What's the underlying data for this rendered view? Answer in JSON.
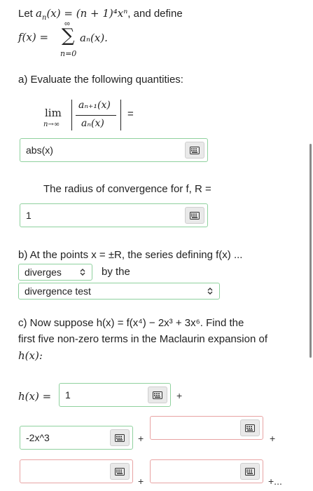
{
  "intro": {
    "prefix": "Let ",
    "an_def": "(n + 1)⁴xⁿ",
    "middle": ", and define",
    "f_label": "f(x) = ",
    "sum_upper": "∞",
    "sum_lower": "n=0",
    "sum_term": "aₙ(x)."
  },
  "part_a": {
    "heading": "a) Evaluate the following quantities:",
    "lim_label": "lim",
    "lim_sub": "n→∞",
    "numerator": "aₙ₊₁(x)",
    "denominator": "aₙ(x)",
    "equals": "=",
    "answer1_value": "abs(x)",
    "radius_text": "The radius of convergence for f, R =",
    "answer2_value": "1"
  },
  "part_b": {
    "heading": "b) At the points x = ±R, the series defining f(x) ...",
    "select1_value": "diverges",
    "by_the": "by the",
    "select2_value": "divergence test"
  },
  "part_c": {
    "line1": "c) Now suppose h(x) = f(x⁴) − 2x³ + 3x⁶. Find the",
    "line2": "first five non-zero terms in the Maclaurin expansion of",
    "line3": "h(x):",
    "h_label": "h(x) =",
    "term1_value": "1",
    "term2_value": "-2x^3",
    "term3_value": "",
    "term4_value": "",
    "term5_value": "",
    "plus": "+",
    "ellipsis": "+..."
  },
  "colors": {
    "correct_border": "#8fd19e",
    "incorrect_border": "#e8a3a3"
  }
}
